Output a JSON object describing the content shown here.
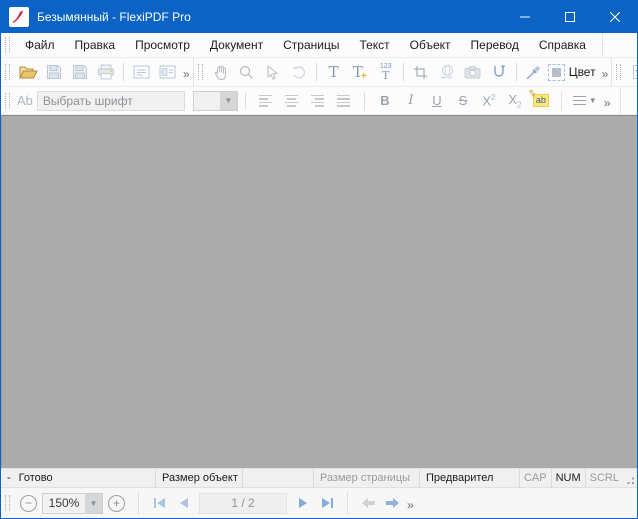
{
  "window": {
    "title": "Безымянный - FlexiPDF Pro"
  },
  "colors": {
    "titlebar_blue": "#0a63c5",
    "canvas_gray": "#ababab",
    "toolbar_bg": "#fcfcfc",
    "disabled_icon": "#b9c6d9",
    "enabled_icon_blue": "#7f9fc6",
    "folder_tan": "#e8c06a",
    "highlight_yellow": "#ffe87a"
  },
  "chrome": {
    "overflow": "»"
  },
  "menubar": {
    "items": [
      "Файл",
      "Правка",
      "Просмотр",
      "Документ",
      "Страницы",
      "Текст",
      "Объект",
      "Перевод",
      "Справка"
    ]
  },
  "toolbar1": {
    "text_tool": "T",
    "text_add": "T",
    "text_add_plus": "+",
    "page_number_top": "123",
    "page_number_bottom": "T",
    "color_label": "Цвет"
  },
  "font_toolbar": {
    "ab_icon": "Ab",
    "font_placeholder": "Выбрать шрифт",
    "bold": "B",
    "italic": "I",
    "underline": "U",
    "strikethrough": "S",
    "sup_base": "X",
    "sup_exp": "2",
    "sub_base": "X",
    "sub_idx": "2",
    "highlight_ab": "ab",
    "highlight_pen": "✎"
  },
  "statusbar": {
    "dash": "-",
    "ready": "Готово",
    "object_size": "Размер объект",
    "page_size": "Размер страницы",
    "preview": "Предварител",
    "caps": "CAP",
    "num": "NUM",
    "scroll": "SCRL"
  },
  "bottombar": {
    "zoom_out": "−",
    "zoom_value": "150%",
    "zoom_in": "+",
    "page_indicator": "1 / 2"
  },
  "icons": {
    "app": "flexipdf-red-swoosh",
    "toolbar1": [
      "open-folder-icon",
      "save-icon",
      "save-as-icon",
      "print-icon",
      "page-layout-icon",
      "page-preview-icon",
      "hand-icon",
      "zoom-icon",
      "cursor-icon",
      "undo-icon",
      "text-edit-icon",
      "text-add-icon",
      "page-number-icon",
      "crop-icon",
      "link-globe-icon",
      "camera-icon",
      "reflow-icon",
      "eyedropper-icon",
      "color-swatch-icon",
      "page-refresh-icon"
    ],
    "toolbar2": [
      "font-ab-icon",
      "align-left-icon",
      "align-center-icon",
      "align-right-icon",
      "align-justify-icon",
      "bold-icon",
      "italic-icon",
      "underline-icon",
      "strikethrough-icon",
      "superscript-icon",
      "subscript-icon",
      "highlighter-icon",
      "line-spacing-icon"
    ],
    "caption": [
      "minimize-icon",
      "maximize-icon",
      "close-icon"
    ]
  }
}
